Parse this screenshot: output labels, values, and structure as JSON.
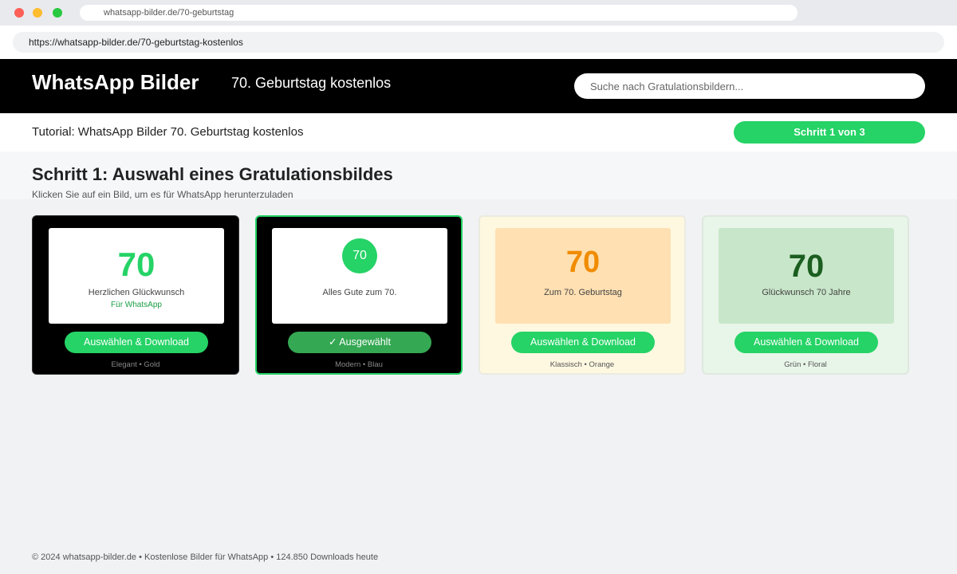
{
  "browser": {
    "tab_url": "whatsapp-bilder.de/70-geburtstag",
    "address": "https://whatsapp-bilder.de/70-geburtstag-kostenlos"
  },
  "header": {
    "logo": "WhatsApp Bilder",
    "subtitle": "70. Geburtstag kostenlos",
    "search_placeholder": "Suche nach Gratulationsbildern..."
  },
  "tutorial": {
    "text": "Tutorial: WhatsApp Bilder 70. Geburtstag kostenlos",
    "step": "Schritt 1 von 3"
  },
  "section": {
    "title": "Schritt 1: Auswahl eines Gratulationsbildes",
    "description": "Klicken Sie auf ein Bild, um es für WhatsApp herunterzuladen"
  },
  "cards": [
    {
      "number": "70",
      "caption": "Herzlichen Glückwunsch",
      "caption_sub": "Für WhatsApp",
      "button": "Auswählen & Download",
      "meta": "Elegant • Gold"
    },
    {
      "number": "70",
      "caption": "Alles Gute zum 70.",
      "button": "✓ Ausgewählt",
      "meta": "Modern • Blau",
      "selected": true
    },
    {
      "number": "70",
      "caption": "Zum 70. Geburtstag",
      "button": "Auswählen & Download",
      "meta": "Klassisch • Orange"
    },
    {
      "number": "70",
      "caption": "Glückwunsch 70 Jahre",
      "button": "Auswählen & Download",
      "meta": "Grün • Floral"
    }
  ],
  "footer": {
    "text": "© 2024 whatsapp-bilder.de • Kostenlose Bilder für WhatsApp • 124.850 Downloads heute"
  },
  "colors": {
    "accent": "#25d366",
    "selected_button": "#34a853",
    "header_bg": "#000000"
  }
}
